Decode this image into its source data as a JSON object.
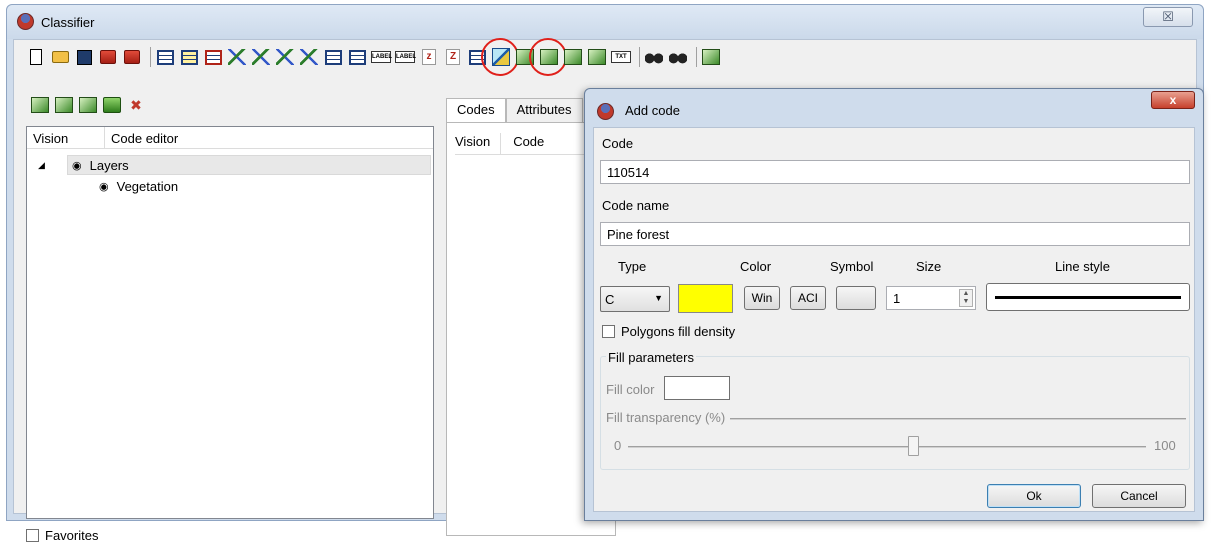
{
  "window": {
    "title": "Classifier",
    "close_label": "☒"
  },
  "toolbar": {
    "row1_icons": [
      "new-document-icon",
      "open-folder-icon",
      "save-disk-icon",
      "copy-red-icon",
      "export-red-icon",
      "table-icon",
      "table-yellow-icon",
      "table-red-icon",
      "line-green-icon",
      "line-blue-icon",
      "line-dashed-icon",
      "line-dots-icon",
      "table-dark-icon",
      "table-grid-icon",
      "label-icon",
      "label-tall-icon",
      "z-icon",
      "z-tall-icon",
      "tree-icon",
      "pen-icon",
      "edit-code-icon",
      "add-code-icon",
      "add-code-blue-icon",
      "code-import-icon",
      "text-box-icon",
      "binoculars-icon",
      "binoculars-small-icon",
      "settings-icon"
    ],
    "row2_icons": [
      "code-edit-icon",
      "code-add-icon",
      "code-remove-icon",
      "code-check-icon",
      "code-delete-icon"
    ]
  },
  "left_panel": {
    "columns": [
      "Vision",
      "Code editor"
    ],
    "tree": [
      {
        "label": "Layers",
        "expanded": true
      },
      {
        "label": "Vegetation"
      }
    ],
    "favorites_label": "Favorites"
  },
  "middle_panel": {
    "tabs": [
      "Codes",
      "Attributes"
    ],
    "columns": [
      "Vision",
      "Code"
    ]
  },
  "dialog": {
    "title": "Add code",
    "close_label": "x",
    "code_label": "Code",
    "code_value": "110514",
    "code_name_label": "Code name",
    "code_name_value": "Pine forest",
    "type_label": "Type",
    "color_label": "Color",
    "symbol_label": "Symbol",
    "size_label": "Size",
    "line_style_label": "Line style",
    "type_value": "C",
    "color_value": "#ffff00",
    "win_label": "Win",
    "aci_label": "ACI",
    "size_value": "1",
    "polygons_fill_label": "Polygons fill density",
    "fill_parameters_label": "Fill parameters",
    "fill_color_label": "Fill color",
    "fill_transparency_label": "Fill transparency (%)",
    "slider_min": "0",
    "slider_max": "100",
    "slider_value": 55,
    "ok_label": "Ok",
    "cancel_label": "Cancel"
  }
}
